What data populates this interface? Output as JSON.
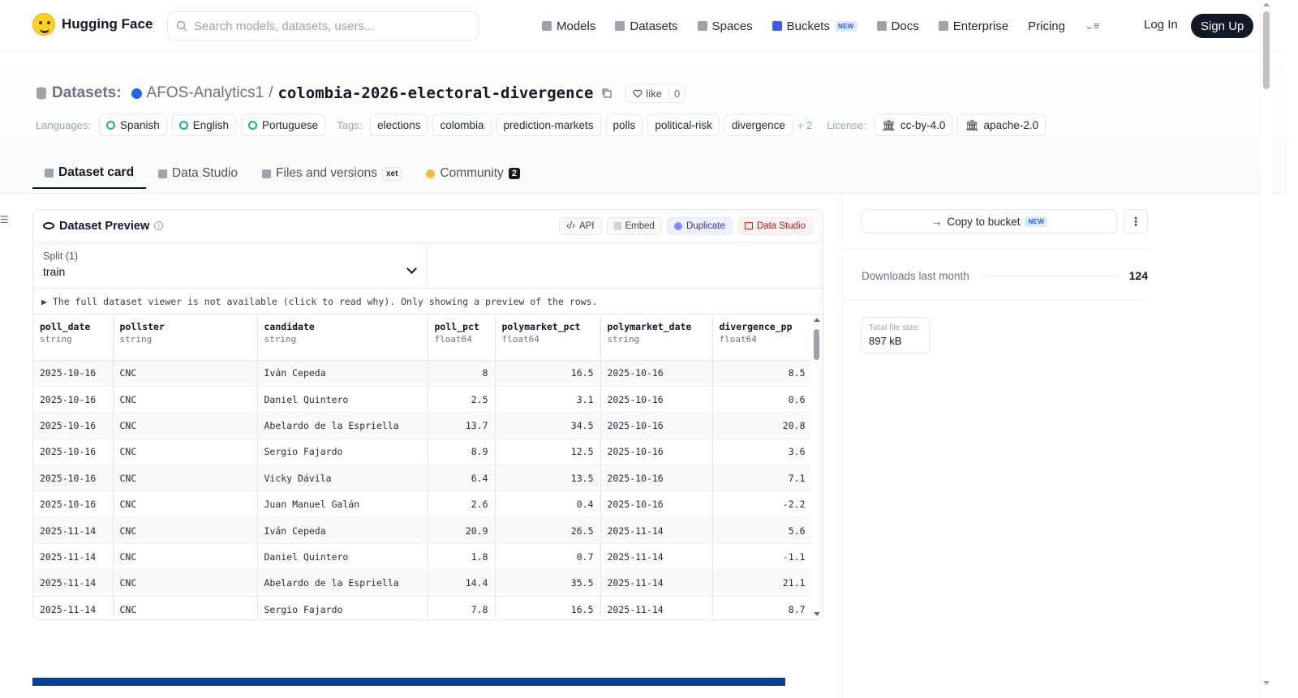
{
  "nav": {
    "brand": "Hugging Face",
    "search_placeholder": "Search models, datasets, users...",
    "links": [
      {
        "label": "Models",
        "icon": "model-icon"
      },
      {
        "label": "Datasets",
        "icon": "dataset-icon"
      },
      {
        "label": "Spaces",
        "icon": "spaces-icon"
      },
      {
        "label": "Buckets",
        "icon": "bucket-icon",
        "badge": "NEW"
      },
      {
        "label": "Docs",
        "icon": "docs-icon"
      },
      {
        "label": "Enterprise",
        "icon": "enterprise-icon"
      },
      {
        "label": "Pricing"
      }
    ],
    "login": "Log In",
    "signup": "Sign Up"
  },
  "repo": {
    "type_label": "Datasets:",
    "org": "AFOS-Analytics1",
    "separator": "/",
    "name": "colombia-2026-electoral-divergence",
    "like_label": "like",
    "like_count": "0"
  },
  "tags": {
    "languages_label": "Languages:",
    "languages": [
      "Spanish",
      "English",
      "Portuguese"
    ],
    "tags_label": "Tags:",
    "tags": [
      "elections",
      "colombia",
      "prediction-markets",
      "polls",
      "political-risk",
      "divergence"
    ],
    "more": "+ 2",
    "license_label": "License:",
    "licenses": [
      "cc-by-4.0",
      "apache-2.0"
    ]
  },
  "tabs": [
    {
      "label": "Dataset card",
      "active": true
    },
    {
      "label": "Data Studio"
    },
    {
      "label": "Files and versions",
      "badge": "xet"
    },
    {
      "label": "Community",
      "count": "2"
    }
  ],
  "preview": {
    "title": "Dataset Preview",
    "buttons": {
      "api": "API",
      "embed": "Embed",
      "duplicate": "Duplicate",
      "data_studio": "Data Studio"
    },
    "split_label": "Split (1)",
    "split_value": "train",
    "notice": "▶ The full dataset viewer is not available (click to read why). Only showing a preview of the rows.",
    "columns": [
      {
        "name": "poll_date",
        "type": "string"
      },
      {
        "name": "pollster",
        "type": "string"
      },
      {
        "name": "candidate",
        "type": "string"
      },
      {
        "name": "poll_pct",
        "type": "float64"
      },
      {
        "name": "polymarket_pct",
        "type": "float64"
      },
      {
        "name": "polymarket_date",
        "type": "string"
      },
      {
        "name": "divergence_pp",
        "type": "float64"
      }
    ],
    "rows": [
      [
        "2025-10-16",
        "CNC",
        "Iván Cepeda",
        "8",
        "16.5",
        "2025-10-16",
        "8.5"
      ],
      [
        "2025-10-16",
        "CNC",
        "Daniel Quintero",
        "2.5",
        "3.1",
        "2025-10-16",
        "0.6"
      ],
      [
        "2025-10-16",
        "CNC",
        "Abelardo de la Espriella",
        "13.7",
        "34.5",
        "2025-10-16",
        "20.8"
      ],
      [
        "2025-10-16",
        "CNC",
        "Sergio Fajardo",
        "8.9",
        "12.5",
        "2025-10-16",
        "3.6"
      ],
      [
        "2025-10-16",
        "CNC",
        "Vicky Dávila",
        "6.4",
        "13.5",
        "2025-10-16",
        "7.1"
      ],
      [
        "2025-10-16",
        "CNC",
        "Juan Manuel Galán",
        "2.6",
        "0.4",
        "2025-10-16",
        "-2.2"
      ],
      [
        "2025-11-14",
        "CNC",
        "Iván Cepeda",
        "20.9",
        "26.5",
        "2025-11-14",
        "5.6"
      ],
      [
        "2025-11-14",
        "CNC",
        "Daniel Quintero",
        "1.8",
        "0.7",
        "2025-11-14",
        "-1.1"
      ],
      [
        "2025-11-14",
        "CNC",
        "Abelardo de la Espriella",
        "14.4",
        "35.5",
        "2025-11-14",
        "21.1"
      ],
      [
        "2025-11-14",
        "CNC",
        "Sergio Fajardo",
        "7.8",
        "16.5",
        "2025-11-14",
        "8.7"
      ]
    ]
  },
  "sidebar": {
    "copy_bucket": "Copy to bucket",
    "copy_badge": "NEW",
    "downloads_label": "Downloads last month",
    "downloads_value": "124",
    "filesize_label": "Total file size:",
    "filesize_value": "897 kB"
  }
}
